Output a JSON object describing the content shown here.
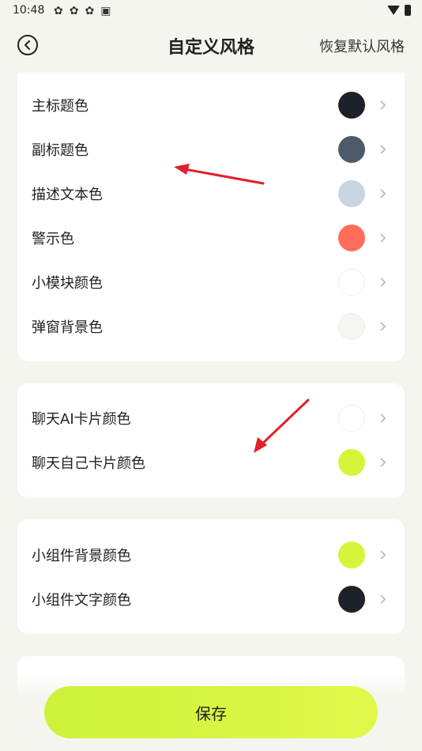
{
  "status_bar": {
    "time": "10:48",
    "notification_icons": [
      "app-icon-1",
      "app-icon-2",
      "app-icon-3",
      "a-badge-icon"
    ]
  },
  "header": {
    "title": "自定义风格",
    "reset_label": "恢复默认风格"
  },
  "sections": [
    {
      "rows": [
        {
          "label": "主标题色",
          "color": "#1d2129"
        },
        {
          "label": "副标题色",
          "color": "#4e5969"
        },
        {
          "label": "描述文本色",
          "color": "#c9d4e3"
        },
        {
          "label": "警示色",
          "color": "#ff6d5a"
        },
        {
          "label": "小模块颜色",
          "color": "#ffffff"
        },
        {
          "label": "弹窗背景色",
          "color": "#f5f5f2"
        }
      ]
    },
    {
      "rows": [
        {
          "label": "聊天AI卡片颜色",
          "color": "#ffffff"
        },
        {
          "label": "聊天自己卡片颜色",
          "color": "#d4f53a"
        }
      ]
    },
    {
      "rows": [
        {
          "label": "小组件背景颜色",
          "color": "#d4f53a"
        },
        {
          "label": "小组件文字颜色",
          "color": "#1d2129"
        }
      ]
    }
  ],
  "save_label": "保存",
  "colors": {
    "accent": "#d4f53a",
    "annotation_arrow": "#e0202a",
    "background": "#f5f5f0"
  }
}
